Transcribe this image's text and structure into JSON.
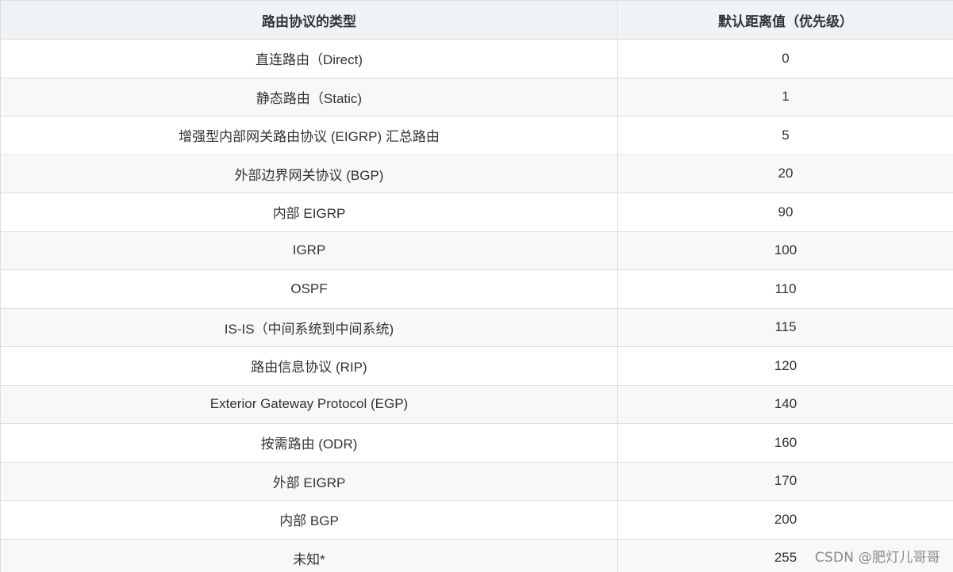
{
  "table": {
    "headers": [
      "路由协议的类型",
      "默认距离值（优先级）"
    ],
    "rows": [
      {
        "type": "直连路由（Direct)",
        "distance": "0"
      },
      {
        "type": "静态路由（Static)",
        "distance": "1"
      },
      {
        "type": "增强型内部网关路由协议 (EIGRP) 汇总路由",
        "distance": "5"
      },
      {
        "type": "外部边界网关协议 (BGP)",
        "distance": "20"
      },
      {
        "type": "内部 EIGRP",
        "distance": "90"
      },
      {
        "type": "IGRP",
        "distance": "100"
      },
      {
        "type": "OSPF",
        "distance": "110"
      },
      {
        "type": "IS-IS（中间系统到中间系统)",
        "distance": "115"
      },
      {
        "type": "路由信息协议 (RIP)",
        "distance": "120"
      },
      {
        "type": "Exterior Gateway Protocol (EGP)",
        "distance": "140"
      },
      {
        "type": "按需路由 (ODR)",
        "distance": "160"
      },
      {
        "type": "外部 EIGRP",
        "distance": "170"
      },
      {
        "type": "内部 BGP",
        "distance": "200"
      },
      {
        "type": "未知*",
        "distance": "255"
      }
    ]
  },
  "watermark": "CSDN @肥灯儿哥哥",
  "colors": {
    "header_bg": "#eff3f5",
    "stripe_bg": "#f8f8f8",
    "border": "#dddddd",
    "text": "#333333"
  }
}
